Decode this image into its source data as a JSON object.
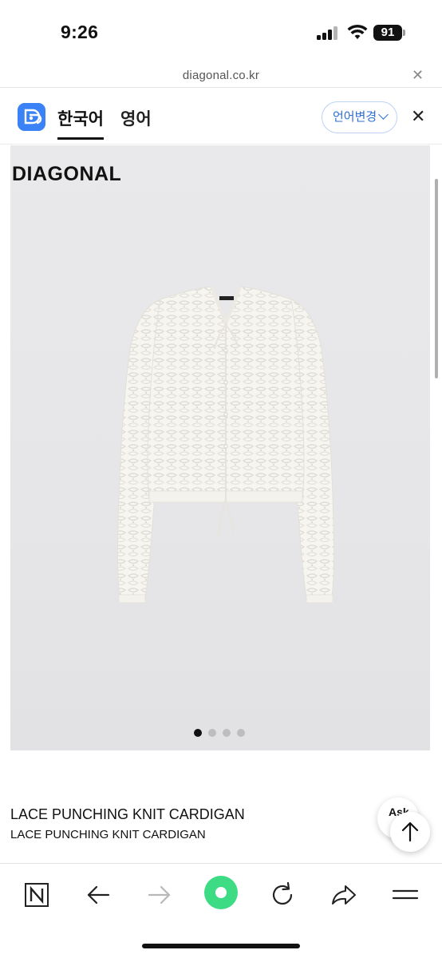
{
  "status_bar": {
    "time": "9:26",
    "battery": "91",
    "icons": [
      "cellular-signal-icon",
      "wifi-icon",
      "battery-icon"
    ]
  },
  "url_bar": {
    "url": "diagonal.co.kr",
    "close_symbol": "✕"
  },
  "translation_bar": {
    "app_icon": "translate-app-icon",
    "tabs": [
      {
        "label": "한국어",
        "active": true
      },
      {
        "label": "영어",
        "active": false
      }
    ],
    "change_language_label": "언어변경",
    "close_symbol": "✕",
    "accent_color": "#2f6fd6"
  },
  "product": {
    "brand": "DIAGONAL",
    "name": "LACE PUNCHING KNIT CARDIGAN",
    "subname": "LACE PUNCHING KNIT CARDIGAN",
    "image_count": 4,
    "current_image": 1
  },
  "floating": {
    "ask_label": "Ask",
    "scroll_top_icon": "arrow-up-icon"
  },
  "toolbar": {
    "buttons": [
      "naver-n-icon",
      "back-arrow-icon",
      "forward-arrow-icon",
      "green-home-icon",
      "refresh-icon",
      "share-icon",
      "menu-icon"
    ],
    "home_color": "#3ddc84"
  }
}
